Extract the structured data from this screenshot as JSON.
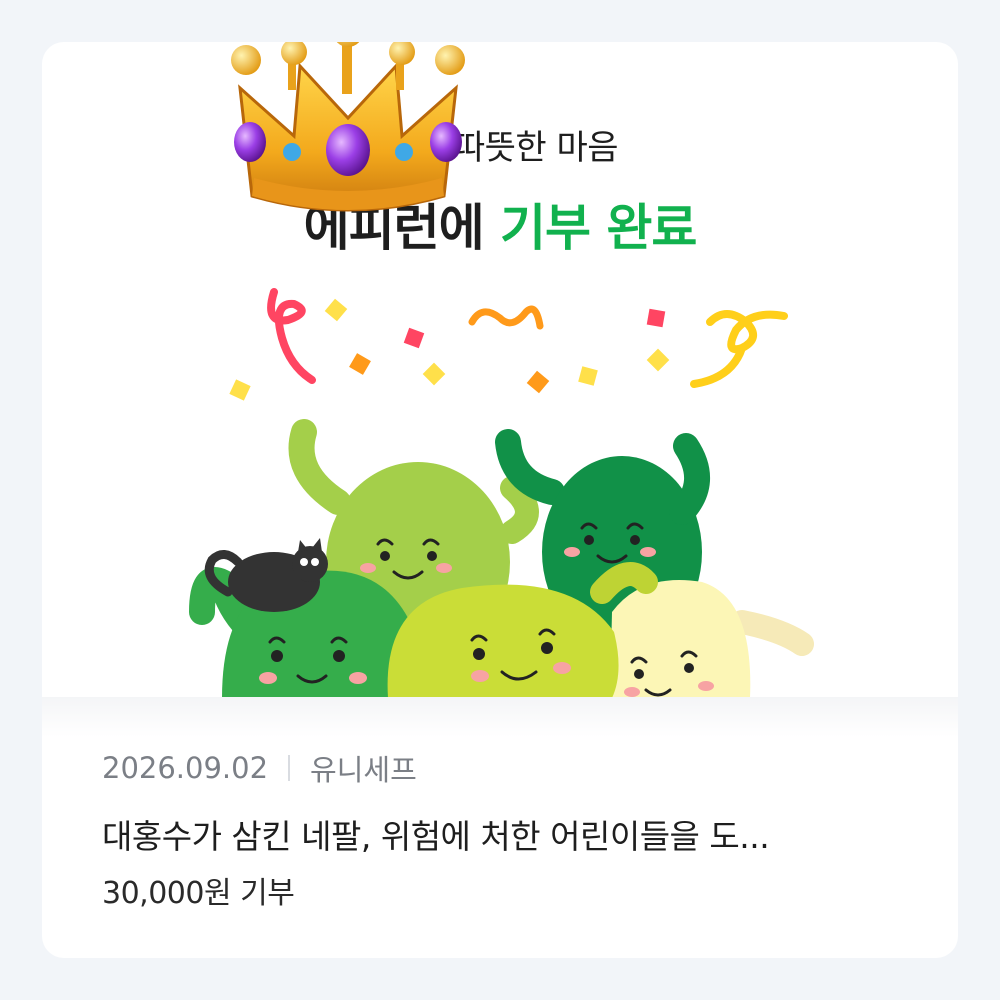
{
  "header": {
    "title_line1": "님의 따뜻한 마음",
    "title_line2_prefix": "에피런에",
    "title_line2_highlight": "기부 완료"
  },
  "badge": {
    "icon": "crown-icon"
  },
  "illustration": {
    "icon": "celebration-characters-illustration"
  },
  "donation": {
    "date": "2026.09.02",
    "organization": "유니세프",
    "title": "대홍수가 삼킨 네팔, 위험에 처한 어린이들을 도...",
    "amount": "30,000원 기부"
  },
  "colors": {
    "accent_green": "#11b14e",
    "background": "#f2f5f9",
    "card": "#ffffff"
  }
}
